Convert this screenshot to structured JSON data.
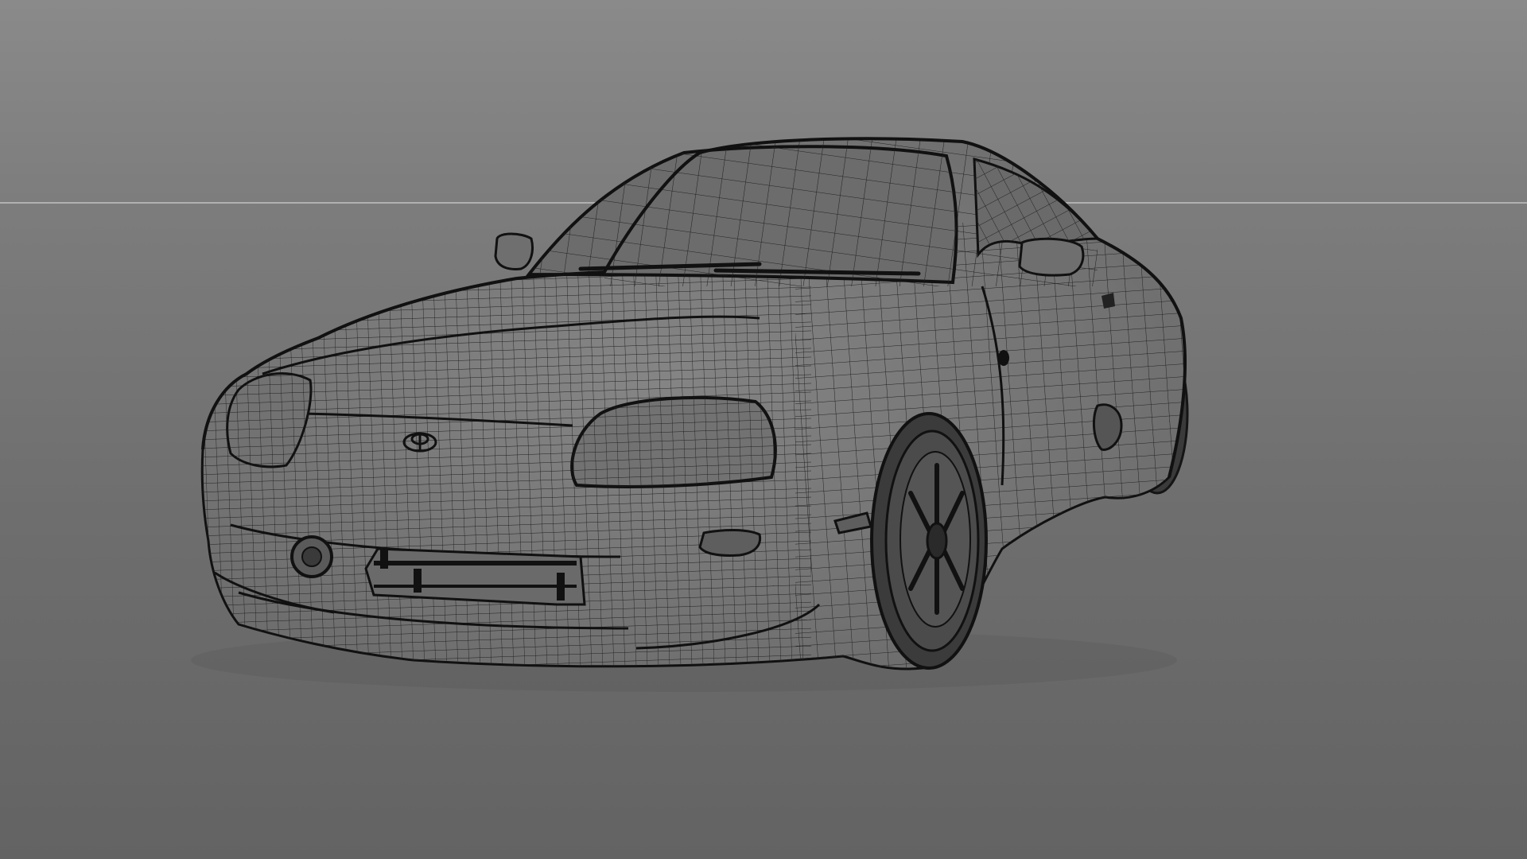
{
  "viewport": {
    "background_top": "#8a8a8a",
    "background_bottom": "#636363",
    "horizon_color": "#b8b8b8",
    "wire_color": "#1e1e1e",
    "body_fill": "#7a7a7a"
  },
  "model": {
    "icon": "car-wireframe-model"
  }
}
